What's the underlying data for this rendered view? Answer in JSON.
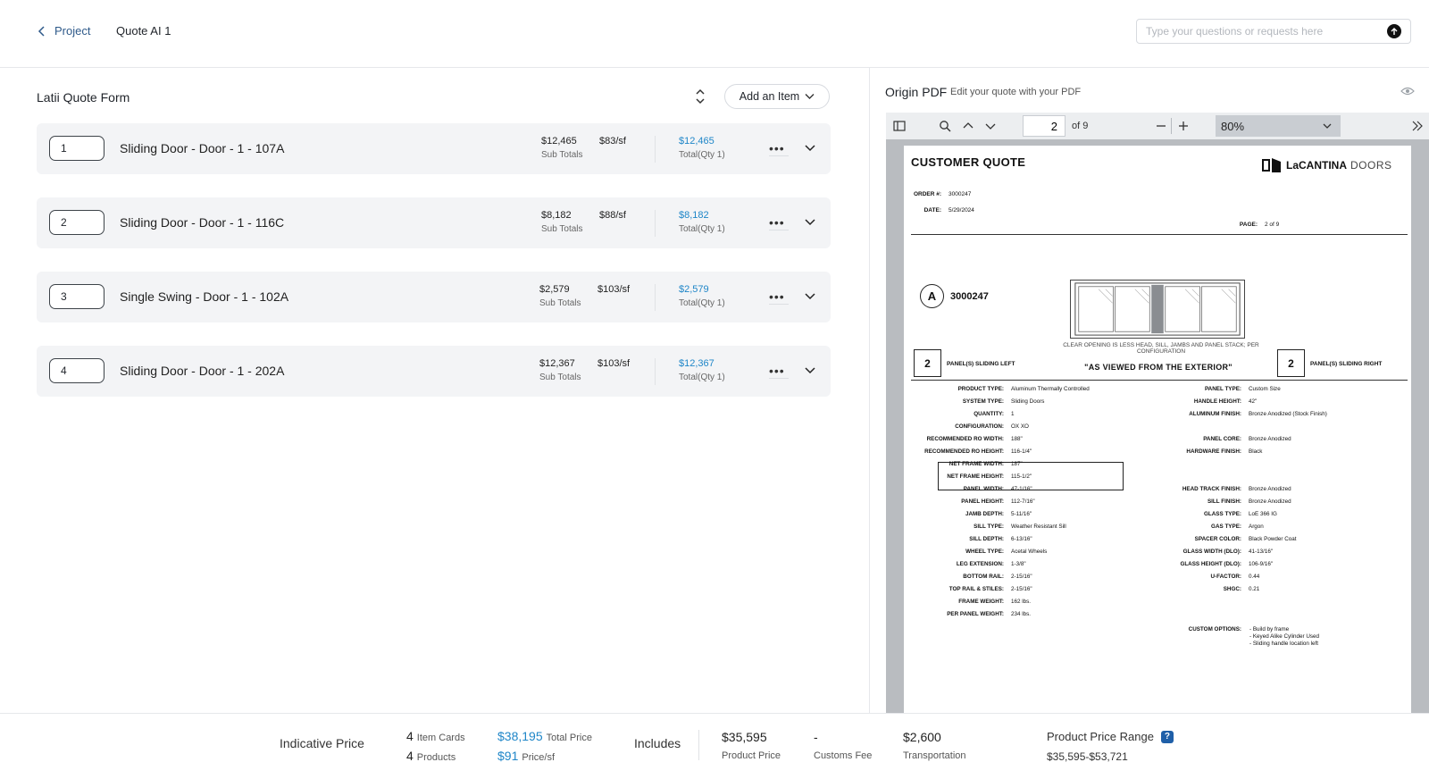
{
  "header": {
    "back_label": "Project",
    "breadcrumb": "Quote AI 1",
    "ask_placeholder": "Type your questions or requests here"
  },
  "form": {
    "title": "Latii Quote Form",
    "add_item_label": "Add an Item",
    "items": [
      {
        "num": "1",
        "name": "Sliding Door - Door - 1 - 107A",
        "subtotal": "$12,465",
        "subtotal_label": "Sub Totals",
        "psf": "$83/sf",
        "total": "$12,465",
        "total_label": "Total(Qty 1)"
      },
      {
        "num": "2",
        "name": "Sliding Door - Door - 1 - 116C",
        "subtotal": "$8,182",
        "subtotal_label": "Sub Totals",
        "psf": "$88/sf",
        "total": "$8,182",
        "total_label": "Total(Qty 1)"
      },
      {
        "num": "3",
        "name": "Single Swing - Door - 1 - 102A",
        "subtotal": "$2,579",
        "subtotal_label": "Sub Totals",
        "psf": "$103/sf",
        "total": "$2,579",
        "total_label": "Total(Qty 1)"
      },
      {
        "num": "4",
        "name": "Sliding Door - Door - 1 - 202A",
        "subtotal": "$12,367",
        "subtotal_label": "Sub Totals",
        "psf": "$103/sf",
        "total": "$12,367",
        "total_label": "Total(Qty 1)"
      }
    ]
  },
  "pdf": {
    "title": "Origin PDF",
    "subtitle": "Edit your quote with your PDF",
    "page_current": "2",
    "page_of": "of 9",
    "zoom": "80%",
    "doc": {
      "title": "CUSTOMER QUOTE",
      "logo_bold": "LaCANTINA",
      "logo_light": "DOORS",
      "order_label": "ORDER #:",
      "order_value": "3000247",
      "date_label": "DATE:",
      "date_value": "5/29/2024",
      "page_label": "PAGE:",
      "page_value": "2 of 9",
      "circle": "A",
      "order_big": "3000247",
      "elev_note": "CLEAR OPENING IS LESS HEAD, SILL, JAMBS AND PANEL STACK; PER CONFIGURATION",
      "left_count": "2",
      "left_label": "PANEL(S) SLIDING LEFT",
      "right_count": "2",
      "right_label": "PANEL(S) SLIDING RIGHT",
      "viewed": "\"AS VIEWED FROM THE EXTERIOR\"",
      "specs_left": [
        {
          "k": "PRODUCT TYPE:",
          "v": "Aluminum Thermally Controlled"
        },
        {
          "k": "SYSTEM TYPE:",
          "v": "Sliding Doors"
        },
        {
          "k": "QUANTITY:",
          "v": "1"
        },
        {
          "k": "CONFIGURATION:",
          "v": "OX XO"
        },
        {
          "k": "RECOMMENDED RO WIDTH:",
          "v": "188\""
        },
        {
          "k": "RECOMMENDED RO HEIGHT:",
          "v": "116-1/4\""
        },
        {
          "k": "NET FRAME WIDTH:",
          "v": "187\""
        },
        {
          "k": "NET FRAME HEIGHT:",
          "v": "115-1/2\""
        },
        {
          "k": "PANEL WIDTH:",
          "v": "47-1/16\""
        },
        {
          "k": "PANEL HEIGHT:",
          "v": "112-7/16\""
        },
        {
          "k": "JAMB DEPTH:",
          "v": "5-11/16\""
        },
        {
          "k": "SILL TYPE:",
          "v": "Weather Resistant Sill"
        },
        {
          "k": "SILL DEPTH:",
          "v": "6-13/16\""
        },
        {
          "k": "WHEEL TYPE:",
          "v": "Acetal Wheels"
        },
        {
          "k": "LEG EXTENSION:",
          "v": "1-3/8\""
        },
        {
          "k": "BOTTOM RAIL:",
          "v": "2-15/16\""
        },
        {
          "k": "TOP RAIL & STILES:",
          "v": "2-15/16\""
        },
        {
          "k": "FRAME WEIGHT:",
          "v": "162 lbs."
        },
        {
          "k": "PER PANEL WEIGHT:",
          "v": "234 lbs."
        }
      ],
      "specs_right": [
        {
          "k": "PANEL TYPE:",
          "v": "Custom Size"
        },
        {
          "k": "HANDLE HEIGHT:",
          "v": "42\""
        },
        {
          "k": "ALUMINUM FINISH:",
          "v": "Bronze Anodized (Stock Finish)"
        },
        {
          "k": "",
          "v": ""
        },
        {
          "k": "PANEL CORE:",
          "v": "Bronze Anodized"
        },
        {
          "k": "HARDWARE FINISH:",
          "v": "Black"
        },
        {
          "k": "",
          "v": ""
        },
        {
          "k": "",
          "v": ""
        },
        {
          "k": "HEAD TRACK FINISH:",
          "v": "Bronze Anodized"
        },
        {
          "k": "SILL FINISH:",
          "v": "Bronze Anodized"
        },
        {
          "k": "GLASS TYPE:",
          "v": "LoE 366 IG"
        },
        {
          "k": "GAS TYPE:",
          "v": "Argon"
        },
        {
          "k": "SPACER COLOR:",
          "v": "Black Powder Coat"
        },
        {
          "k": "GLASS WIDTH (DLO):",
          "v": "41-13/16\""
        },
        {
          "k": "GLASS HEIGHT (DLO):",
          "v": "106-9/16\""
        },
        {
          "k": "U-FACTOR:",
          "v": "0.44"
        },
        {
          "k": "SHGC:",
          "v": "0.21"
        }
      ],
      "custom_label": "CUSTOM OPTIONS:",
      "custom_options": [
        "- Build by frame",
        "- Keyed Alike Cylinder Used",
        "- Sliding handle location left"
      ]
    }
  },
  "footer": {
    "indicative": "Indicative Price",
    "item_cards_n": "4",
    "item_cards_lbl": "Item Cards",
    "products_n": "4",
    "products_lbl": "Products",
    "total_price": "$38,195",
    "total_price_lbl": "Total Price",
    "price_sf": "$91",
    "price_sf_lbl": "Price/sf",
    "includes": "Includes",
    "product_price": "$35,595",
    "product_price_lbl": "Product Price",
    "customs_fee": "-",
    "customs_fee_lbl": "Customs Fee",
    "transportation": "$2,600",
    "transportation_lbl": "Transportation",
    "range_lbl": "Product Price Range",
    "range_help": "?",
    "range_val": "$35,595-$53,721"
  }
}
